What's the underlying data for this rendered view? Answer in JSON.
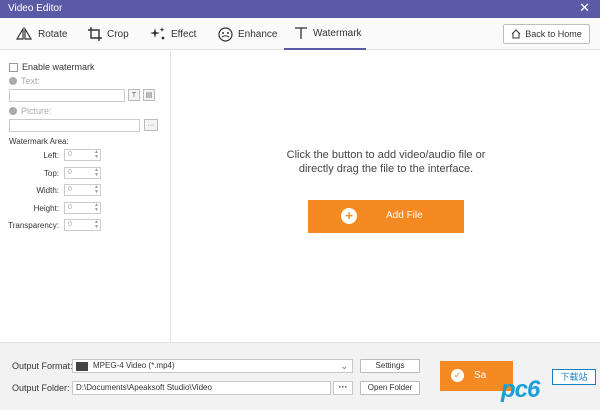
{
  "window": {
    "title": "Video Editor",
    "close_glyph": "✕"
  },
  "toolbar": {
    "tabs": [
      {
        "label": "Rotate",
        "icon": "rotate-icon"
      },
      {
        "label": "Crop",
        "icon": "crop-icon"
      },
      {
        "label": "Effect",
        "icon": "effect-icon"
      },
      {
        "label": "Enhance",
        "icon": "enhance-icon"
      },
      {
        "label": "Watermark",
        "icon": "watermark-icon",
        "active": true
      }
    ],
    "back_home_label": "Back to Home"
  },
  "watermark_panel": {
    "enable_label": "Enable watermark",
    "text_label": "Text:",
    "text_btn_1": "T",
    "text_btn_2": "▤",
    "picture_label": "Picture:",
    "picture_btn": "···",
    "area_label": "Watermark Area:",
    "fields": [
      {
        "label": "Left:",
        "value": "0"
      },
      {
        "label": "Top:",
        "value": "0"
      },
      {
        "label": "Width:",
        "value": "0"
      },
      {
        "label": "Height:",
        "value": "0"
      },
      {
        "label": "Transparency:",
        "value": "0"
      }
    ]
  },
  "dropzone": {
    "hint_line1": "Click the button to add video/audio file or",
    "hint_line2": "directly drag the file to the interface.",
    "add_file_label": "Add File",
    "plus_glyph": "+"
  },
  "output": {
    "format_label": "Output Format:",
    "format_value": "MPEG-4 Video (*.mp4)",
    "format_caret": "⌄",
    "settings_label": "Settings",
    "folder_label": "Output Folder:",
    "folder_value": "D:\\Documents\\Apeaksoft Studio\\Video",
    "browse_label": "···",
    "open_folder_label": "Open Folder",
    "save_label": "Sa",
    "save_glyph": "✓"
  },
  "watermark_overlay": {
    "site": "pc6",
    "badge": "下载站"
  },
  "colors": {
    "titlebar": "#5b5aa6",
    "accent_orange": "#f58a22",
    "site_blue": "#1a9fd7"
  }
}
